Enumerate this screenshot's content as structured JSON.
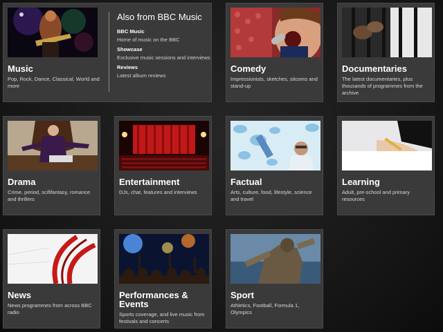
{
  "also_from": {
    "heading": "Also from BBC Music",
    "links": [
      {
        "label": "BBC Music",
        "desc": "Home of music on the BBC"
      },
      {
        "label": "Showcase",
        "desc": "Exclusive music sessions and interviews"
      },
      {
        "label": "Reviews",
        "desc": "Latest album reviews"
      }
    ]
  },
  "tiles": [
    {
      "title": "Music",
      "desc": "Pop, Rock, Dance, Classical, World and more"
    },
    {
      "title": "Comedy",
      "desc": "Impressionists, sketches, sitcoms and stand-up"
    },
    {
      "title": "Documentaries",
      "desc": "The latest documentaries, plus thousands of programmes from the archive"
    },
    {
      "title": "Drama",
      "desc": "Crime, period, scififantasy, romance and thrillers"
    },
    {
      "title": "Entertainment",
      "desc": "DJs, chat, features and interviews"
    },
    {
      "title": "Factual",
      "desc": "Arts, culture, food, lifestyle, science and travel"
    },
    {
      "title": "Learning",
      "desc": "Adult, pre-school and primary resources"
    },
    {
      "title": "News",
      "desc": "News programmes from across BBC radio"
    },
    {
      "title": "Performances & Events",
      "desc": "Sports coverage, and live music from festivals and concerts"
    },
    {
      "title": "Sport",
      "desc": "Athletics, Football, Formula 1, Olympics"
    }
  ]
}
